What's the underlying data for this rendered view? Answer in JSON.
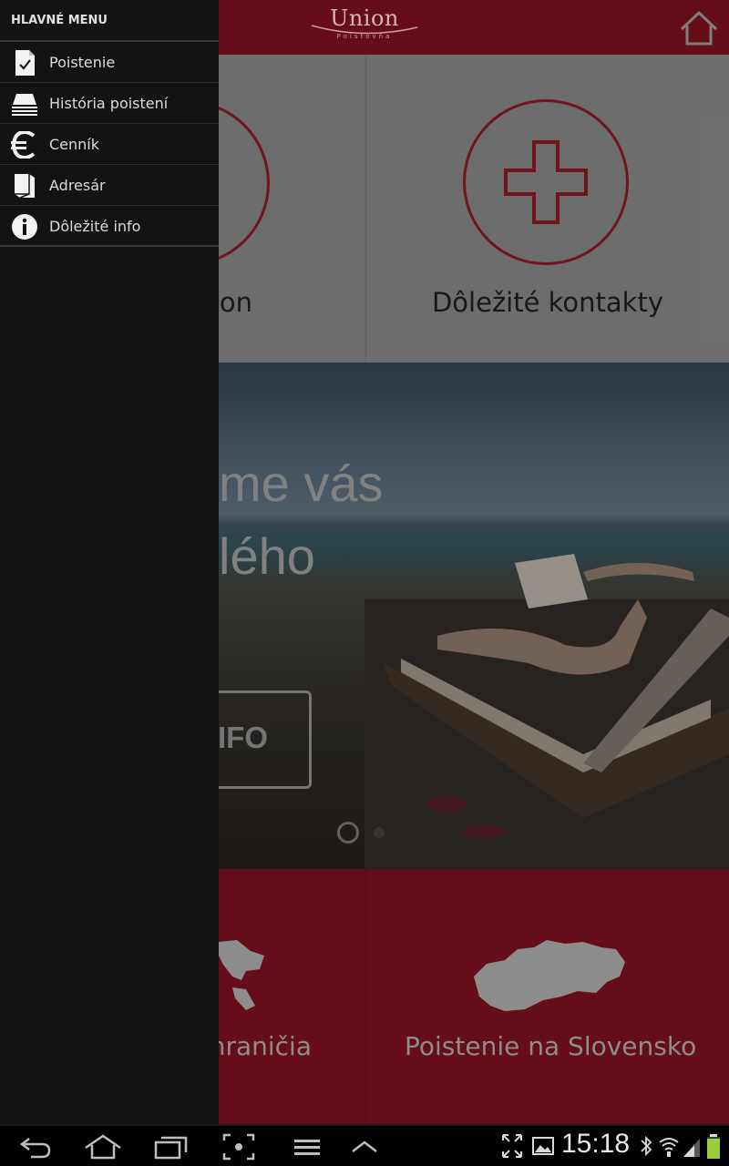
{
  "app": {
    "logo_word": "Union",
    "logo_sub": "Poisťovňa"
  },
  "tiles_top": {
    "left_label": "on",
    "right_label": "Dôležité kontakty"
  },
  "banner": {
    "line1": "me vás",
    "line2": "lého",
    "button": "IFO",
    "pager": {
      "current": 1,
      "total": 2
    }
  },
  "tiles_bottom": {
    "left_label": "hraničia",
    "right_label": "Poistenie na Slovensko"
  },
  "drawer": {
    "header": "HLAVNÉ MENU",
    "items": [
      {
        "label": "Poistenie",
        "icon": "document-check-icon"
      },
      {
        "label": "História poistení",
        "icon": "stack-icon"
      },
      {
        "label": "Cenník",
        "icon": "euro-icon"
      },
      {
        "label": "Adresár",
        "icon": "address-book-icon"
      },
      {
        "label": "Dôležité info",
        "icon": "info-icon"
      }
    ]
  },
  "statusbar": {
    "time": "15:18",
    "battery_level": 0.9
  },
  "colors": {
    "brand": "#6e0f1c",
    "drawer_bg": "#131313"
  }
}
